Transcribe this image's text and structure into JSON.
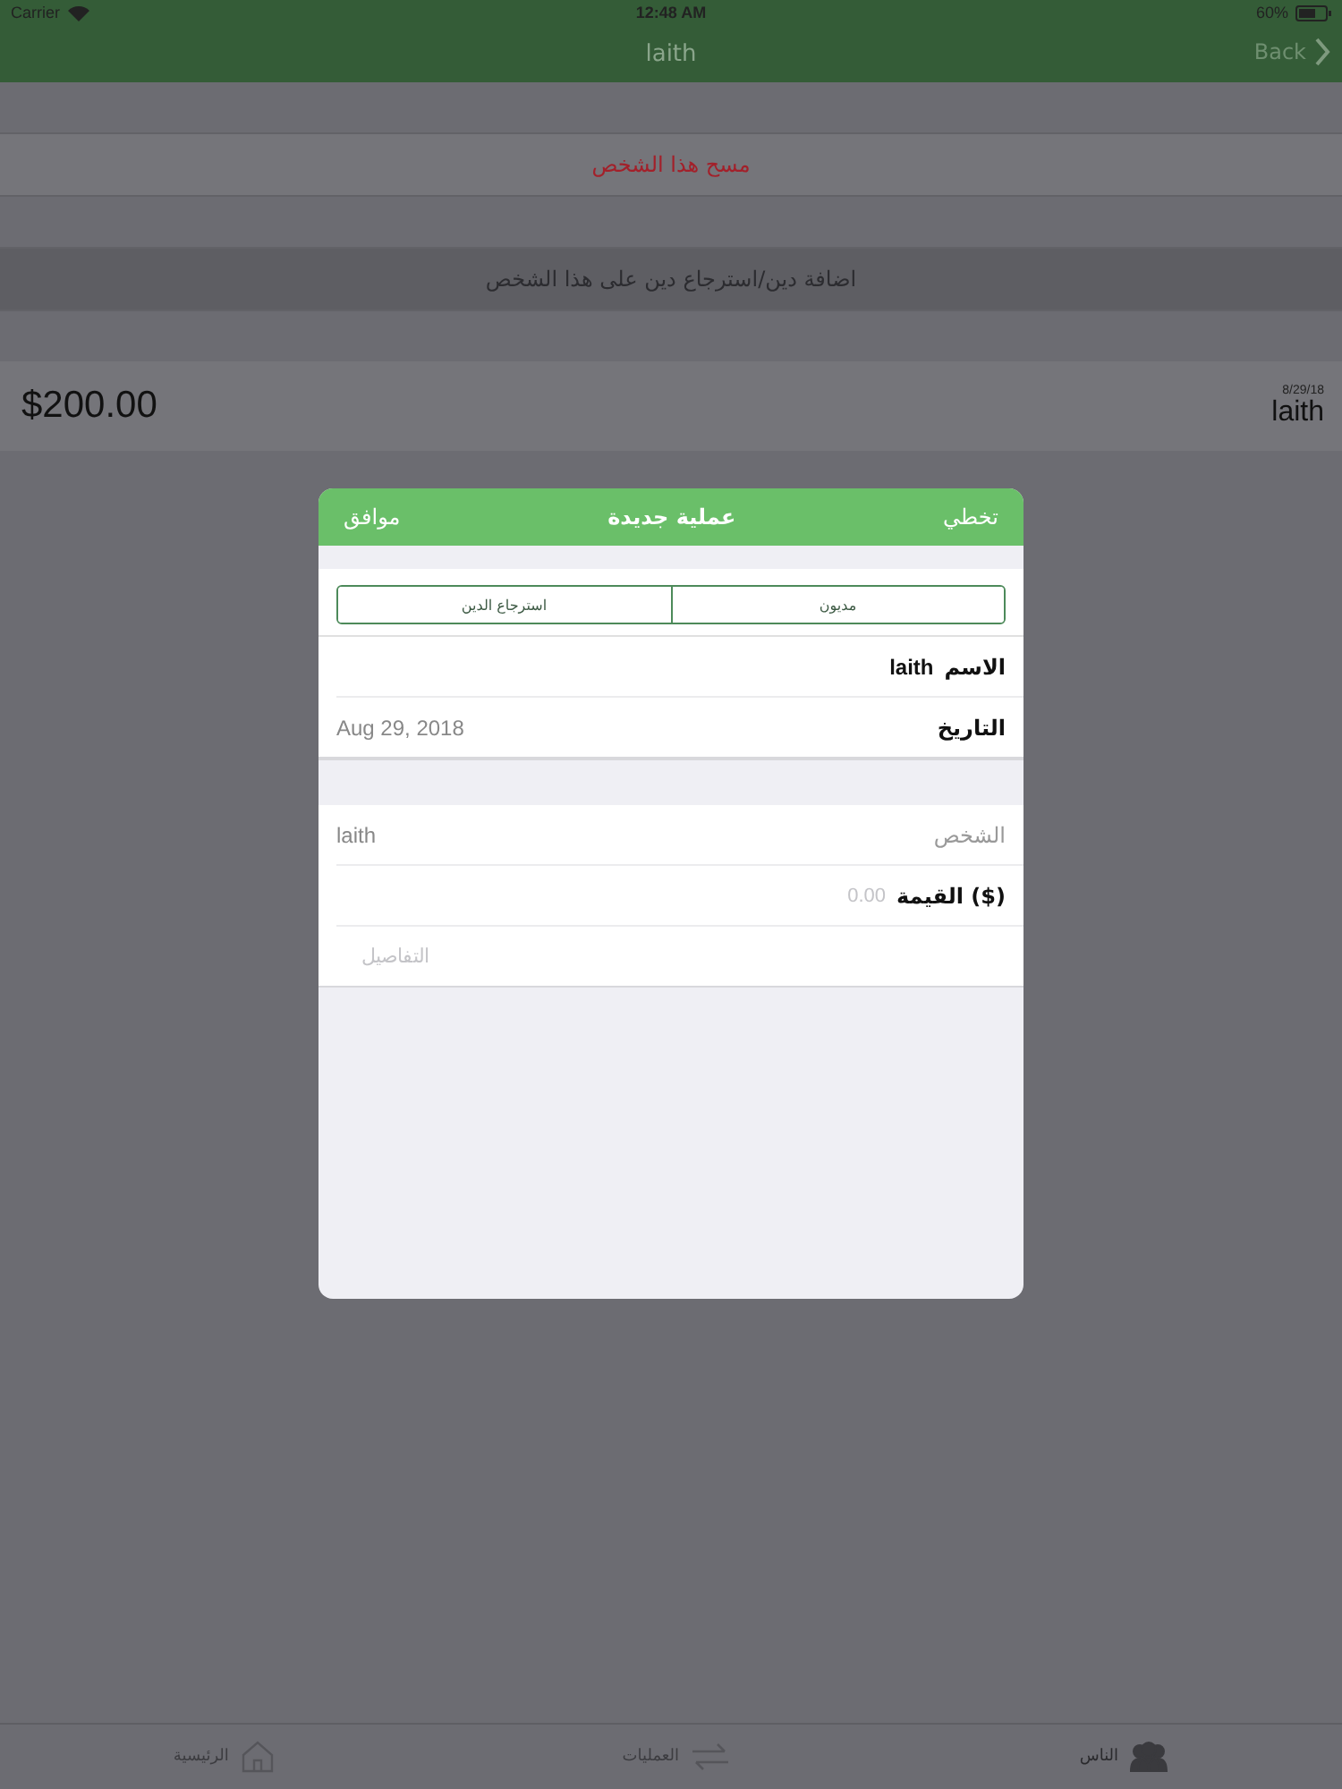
{
  "status_bar": {
    "carrier": "Carrier",
    "time": "12:48 AM",
    "battery": "60%"
  },
  "nav": {
    "title": "laith",
    "back": "Back"
  },
  "actions": [
    {
      "label": "مسح هذا الشخص",
      "kind": "destructive"
    },
    {
      "label": "اضافة دين/استرجاع دين على هذا الشخص",
      "kind": "plain"
    }
  ],
  "entry": {
    "date": "8/29/18",
    "name": "laith",
    "amount": "$200.00"
  },
  "dialog": {
    "cancel": "تخطي",
    "title": "عملية جديدة",
    "confirm": "موافق",
    "segments": [
      {
        "label": "مديون",
        "selected": false
      },
      {
        "label": "استرجاع الدين",
        "selected": false
      }
    ],
    "sections": [
      [
        {
          "kind": "inline",
          "label": "الاسم",
          "bold": true,
          "value": "laith"
        },
        {
          "kind": "detail",
          "label": "التاريخ",
          "bold": true,
          "value": "Aug 29, 2018"
        }
      ],
      [
        {
          "kind": "detail",
          "label": "الشخص",
          "bold": false,
          "value": "laith"
        },
        {
          "kind": "input",
          "label": "القيمة ($)",
          "bold": true,
          "placeholder": "0.00"
        },
        {
          "kind": "input",
          "placeholder": "التفاصيل"
        }
      ]
    ]
  },
  "tab_bar": [
    {
      "label": "الناس",
      "selected": true
    },
    {
      "label": "العمليات",
      "selected": false
    },
    {
      "label": "الرئيسية",
      "selected": false
    }
  ]
}
